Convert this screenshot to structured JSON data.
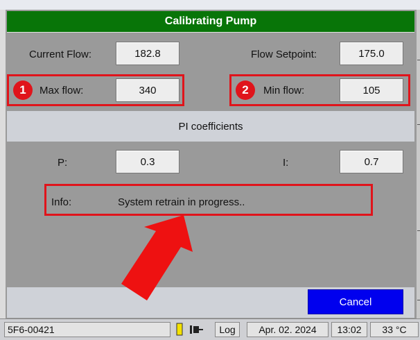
{
  "dialog": {
    "title": "Calibrating Pump",
    "current_flow": {
      "label": "Current Flow:",
      "value": "182.8"
    },
    "flow_setpoint": {
      "label": "Flow Setpoint:",
      "value": "175.0"
    },
    "max_flow": {
      "badge": "1",
      "label": "Max flow:",
      "value": "340"
    },
    "min_flow": {
      "badge": "2",
      "label": "Min flow:",
      "value": "105"
    },
    "pi_section": {
      "title": "PI coefficients"
    },
    "p_coef": {
      "label": "P:",
      "value": "0.3"
    },
    "i_coef": {
      "label": "I:",
      "value": "0.7"
    },
    "info": {
      "label": "Info:",
      "text": "System retrain in progress.."
    },
    "cancel_label": "Cancel"
  },
  "status_bar": {
    "device_id": "5F6-00421",
    "log_label": "Log",
    "date": "Apr. 02. 2024",
    "time": "13:02",
    "temperature": "33 °C"
  },
  "colors": {
    "title_bg": "#087508",
    "highlight": "#e0141b",
    "cancel_bg": "#0000ee",
    "panel_bg": "#9a9a9a"
  }
}
